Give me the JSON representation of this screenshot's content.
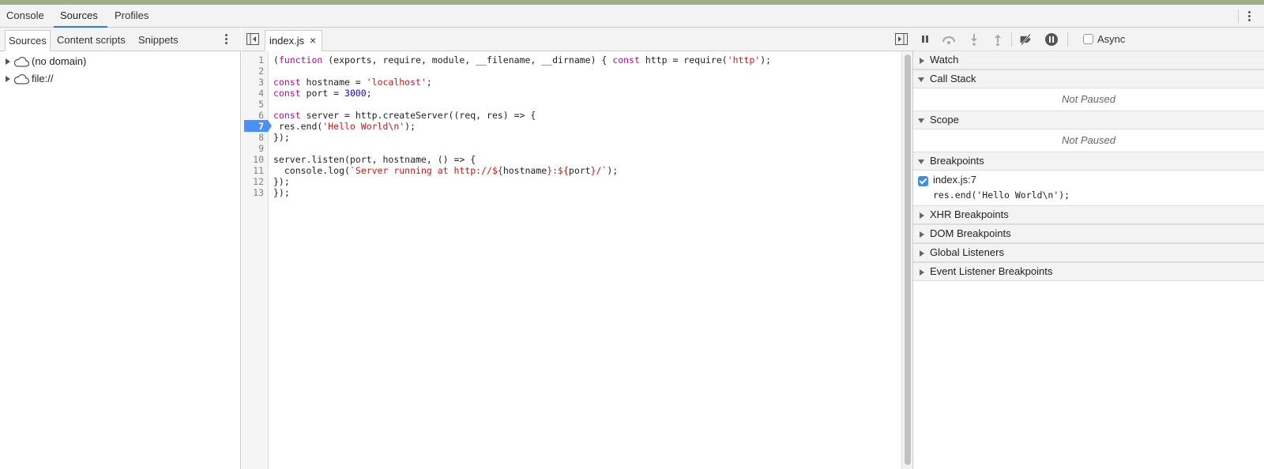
{
  "main_tabs": [
    "Console",
    "Sources",
    "Profiles"
  ],
  "main_tab_selected": "Sources",
  "navigator": {
    "tabs": [
      "Sources",
      "Content scripts",
      "Snippets"
    ],
    "selected": "Sources",
    "tree": [
      {
        "label": "(no domain)",
        "icon": "cloud-icon"
      },
      {
        "label": "file://",
        "icon": "cloud-icon"
      }
    ]
  },
  "editor": {
    "file_tab": "index.js",
    "close_glyph": "×",
    "line_numbers": [
      "1",
      "2",
      "3",
      "4",
      "5",
      "6",
      "7",
      "8",
      "9",
      "10",
      "11",
      "12",
      "13"
    ],
    "breakpoint_line": 7,
    "code_lines": [
      "(function (exports, require, module, __filename, __dirname) { const http = require('http');",
      "",
      "const hostname = 'localhost';",
      "const port = 3000;",
      "",
      "const server = http.createServer((req, res) => {",
      " res.end('Hello World\\n');",
      "});",
      "",
      "server.listen(port, hostname, () => {",
      "  console.log(`Server running at http://${hostname}:${port}/`);",
      "});",
      "});"
    ]
  },
  "debugger": {
    "toolbar": {
      "async_label": "Async",
      "async_checked": false,
      "buttons": [
        "pause-icon",
        "step-over-icon",
        "step-into-icon",
        "step-out-icon",
        "deactivate-breakpoints-icon",
        "pause-on-exceptions-icon"
      ]
    },
    "panes": {
      "watch": "Watch",
      "call_stack": "Call Stack",
      "call_stack_status": "Not Paused",
      "scope": "Scope",
      "scope_status": "Not Paused",
      "breakpoints": "Breakpoints",
      "breakpoint_file": "index.js:7",
      "breakpoint_code": "res.end('Hello World\\n');",
      "xhr": "XHR Breakpoints",
      "dom": "DOM Breakpoints",
      "global": "Global Listeners",
      "event": "Event Listener Breakpoints"
    }
  },
  "colors": {
    "accent": "#3879d9",
    "breakpoint_marker": "#4d8ff5",
    "keyword": "#aa0d91",
    "string": "#c41a16",
    "number": "#1c00cf"
  }
}
